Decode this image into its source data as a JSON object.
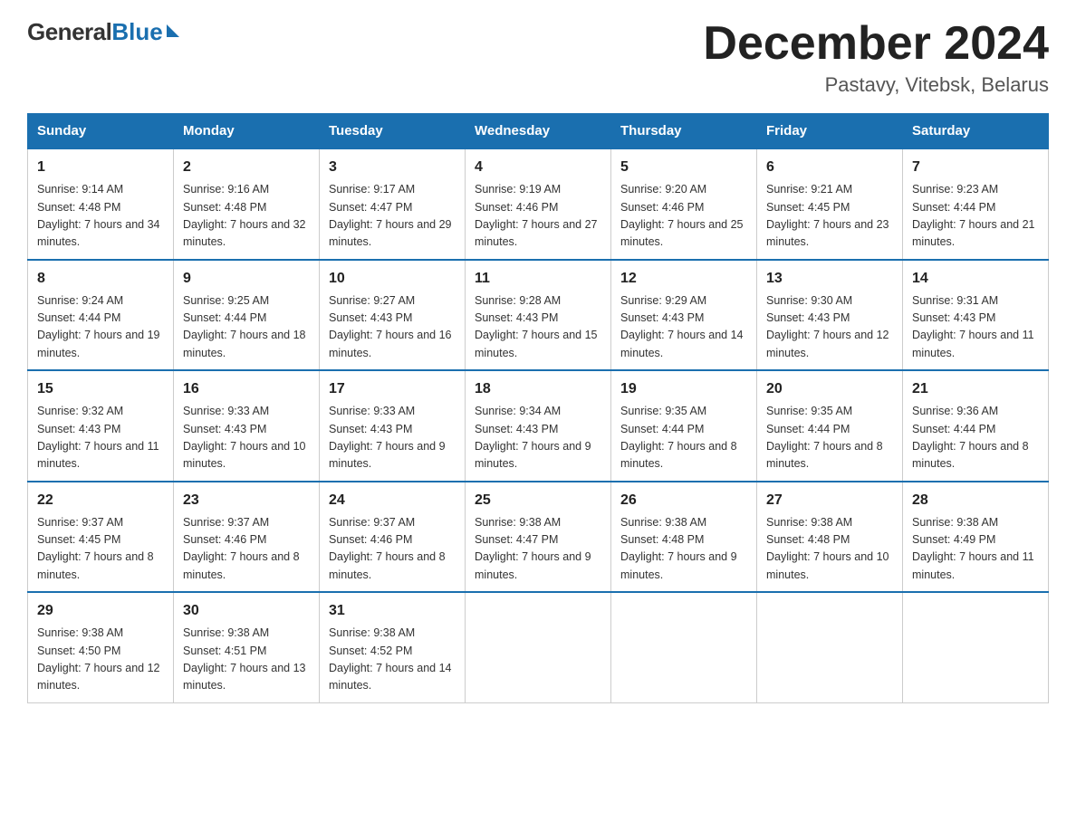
{
  "logo": {
    "general": "General",
    "blue": "Blue"
  },
  "header": {
    "month": "December 2024",
    "location": "Pastavy, Vitebsk, Belarus"
  },
  "weekdays": [
    "Sunday",
    "Monday",
    "Tuesday",
    "Wednesday",
    "Thursday",
    "Friday",
    "Saturday"
  ],
  "weeks": [
    [
      {
        "day": "1",
        "sunrise": "Sunrise: 9:14 AM",
        "sunset": "Sunset: 4:48 PM",
        "daylight": "Daylight: 7 hours and 34 minutes."
      },
      {
        "day": "2",
        "sunrise": "Sunrise: 9:16 AM",
        "sunset": "Sunset: 4:48 PM",
        "daylight": "Daylight: 7 hours and 32 minutes."
      },
      {
        "day": "3",
        "sunrise": "Sunrise: 9:17 AM",
        "sunset": "Sunset: 4:47 PM",
        "daylight": "Daylight: 7 hours and 29 minutes."
      },
      {
        "day": "4",
        "sunrise": "Sunrise: 9:19 AM",
        "sunset": "Sunset: 4:46 PM",
        "daylight": "Daylight: 7 hours and 27 minutes."
      },
      {
        "day": "5",
        "sunrise": "Sunrise: 9:20 AM",
        "sunset": "Sunset: 4:46 PM",
        "daylight": "Daylight: 7 hours and 25 minutes."
      },
      {
        "day": "6",
        "sunrise": "Sunrise: 9:21 AM",
        "sunset": "Sunset: 4:45 PM",
        "daylight": "Daylight: 7 hours and 23 minutes."
      },
      {
        "day": "7",
        "sunrise": "Sunrise: 9:23 AM",
        "sunset": "Sunset: 4:44 PM",
        "daylight": "Daylight: 7 hours and 21 minutes."
      }
    ],
    [
      {
        "day": "8",
        "sunrise": "Sunrise: 9:24 AM",
        "sunset": "Sunset: 4:44 PM",
        "daylight": "Daylight: 7 hours and 19 minutes."
      },
      {
        "day": "9",
        "sunrise": "Sunrise: 9:25 AM",
        "sunset": "Sunset: 4:44 PM",
        "daylight": "Daylight: 7 hours and 18 minutes."
      },
      {
        "day": "10",
        "sunrise": "Sunrise: 9:27 AM",
        "sunset": "Sunset: 4:43 PM",
        "daylight": "Daylight: 7 hours and 16 minutes."
      },
      {
        "day": "11",
        "sunrise": "Sunrise: 9:28 AM",
        "sunset": "Sunset: 4:43 PM",
        "daylight": "Daylight: 7 hours and 15 minutes."
      },
      {
        "day": "12",
        "sunrise": "Sunrise: 9:29 AM",
        "sunset": "Sunset: 4:43 PM",
        "daylight": "Daylight: 7 hours and 14 minutes."
      },
      {
        "day": "13",
        "sunrise": "Sunrise: 9:30 AM",
        "sunset": "Sunset: 4:43 PM",
        "daylight": "Daylight: 7 hours and 12 minutes."
      },
      {
        "day": "14",
        "sunrise": "Sunrise: 9:31 AM",
        "sunset": "Sunset: 4:43 PM",
        "daylight": "Daylight: 7 hours and 11 minutes."
      }
    ],
    [
      {
        "day": "15",
        "sunrise": "Sunrise: 9:32 AM",
        "sunset": "Sunset: 4:43 PM",
        "daylight": "Daylight: 7 hours and 11 minutes."
      },
      {
        "day": "16",
        "sunrise": "Sunrise: 9:33 AM",
        "sunset": "Sunset: 4:43 PM",
        "daylight": "Daylight: 7 hours and 10 minutes."
      },
      {
        "day": "17",
        "sunrise": "Sunrise: 9:33 AM",
        "sunset": "Sunset: 4:43 PM",
        "daylight": "Daylight: 7 hours and 9 minutes."
      },
      {
        "day": "18",
        "sunrise": "Sunrise: 9:34 AM",
        "sunset": "Sunset: 4:43 PM",
        "daylight": "Daylight: 7 hours and 9 minutes."
      },
      {
        "day": "19",
        "sunrise": "Sunrise: 9:35 AM",
        "sunset": "Sunset: 4:44 PM",
        "daylight": "Daylight: 7 hours and 8 minutes."
      },
      {
        "day": "20",
        "sunrise": "Sunrise: 9:35 AM",
        "sunset": "Sunset: 4:44 PM",
        "daylight": "Daylight: 7 hours and 8 minutes."
      },
      {
        "day": "21",
        "sunrise": "Sunrise: 9:36 AM",
        "sunset": "Sunset: 4:44 PM",
        "daylight": "Daylight: 7 hours and 8 minutes."
      }
    ],
    [
      {
        "day": "22",
        "sunrise": "Sunrise: 9:37 AM",
        "sunset": "Sunset: 4:45 PM",
        "daylight": "Daylight: 7 hours and 8 minutes."
      },
      {
        "day": "23",
        "sunrise": "Sunrise: 9:37 AM",
        "sunset": "Sunset: 4:46 PM",
        "daylight": "Daylight: 7 hours and 8 minutes."
      },
      {
        "day": "24",
        "sunrise": "Sunrise: 9:37 AM",
        "sunset": "Sunset: 4:46 PM",
        "daylight": "Daylight: 7 hours and 8 minutes."
      },
      {
        "day": "25",
        "sunrise": "Sunrise: 9:38 AM",
        "sunset": "Sunset: 4:47 PM",
        "daylight": "Daylight: 7 hours and 9 minutes."
      },
      {
        "day": "26",
        "sunrise": "Sunrise: 9:38 AM",
        "sunset": "Sunset: 4:48 PM",
        "daylight": "Daylight: 7 hours and 9 minutes."
      },
      {
        "day": "27",
        "sunrise": "Sunrise: 9:38 AM",
        "sunset": "Sunset: 4:48 PM",
        "daylight": "Daylight: 7 hours and 10 minutes."
      },
      {
        "day": "28",
        "sunrise": "Sunrise: 9:38 AM",
        "sunset": "Sunset: 4:49 PM",
        "daylight": "Daylight: 7 hours and 11 minutes."
      }
    ],
    [
      {
        "day": "29",
        "sunrise": "Sunrise: 9:38 AM",
        "sunset": "Sunset: 4:50 PM",
        "daylight": "Daylight: 7 hours and 12 minutes."
      },
      {
        "day": "30",
        "sunrise": "Sunrise: 9:38 AM",
        "sunset": "Sunset: 4:51 PM",
        "daylight": "Daylight: 7 hours and 13 minutes."
      },
      {
        "day": "31",
        "sunrise": "Sunrise: 9:38 AM",
        "sunset": "Sunset: 4:52 PM",
        "daylight": "Daylight: 7 hours and 14 minutes."
      },
      null,
      null,
      null,
      null
    ]
  ]
}
